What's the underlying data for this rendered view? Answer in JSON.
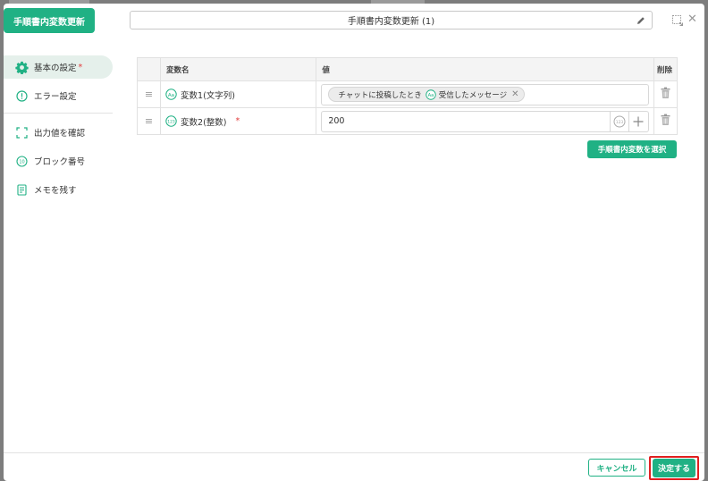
{
  "header": {
    "tag_label": "手順書内変数更新",
    "title_value": "手順書内変数更新 (1)"
  },
  "sidebar": {
    "items": [
      {
        "label": "基本の設定",
        "required": "*",
        "icon": "gear-icon"
      },
      {
        "label": "エラー設定",
        "icon": "alert-circle-icon"
      },
      {
        "label": "出力値を確認",
        "icon": "frame-icon"
      },
      {
        "label": "ブロック番号",
        "icon": "number-badge-icon"
      },
      {
        "label": "メモを残す",
        "icon": "memo-icon"
      }
    ]
  },
  "table": {
    "headers": {
      "name": "変数名",
      "value": "値",
      "delete": "削除"
    },
    "rows": [
      {
        "name": "変数1(文字列)",
        "type_icon": "Aa",
        "chip_prefix": "チャットに投稿したとき",
        "chip_icon": "Aa",
        "chip_label": "受信したメッセージ"
      },
      {
        "name": "変数2(整数)",
        "type_icon": "123",
        "required": "*",
        "value": "200"
      }
    ],
    "drag_glyph": "≡"
  },
  "select_button": "手順書内変数を選択",
  "footer": {
    "cancel_label": "キャンセル",
    "ok_label": "決定する"
  },
  "colors": {
    "accent": "#20b184",
    "required": "#e23c3c",
    "highlight": "#e02020"
  }
}
